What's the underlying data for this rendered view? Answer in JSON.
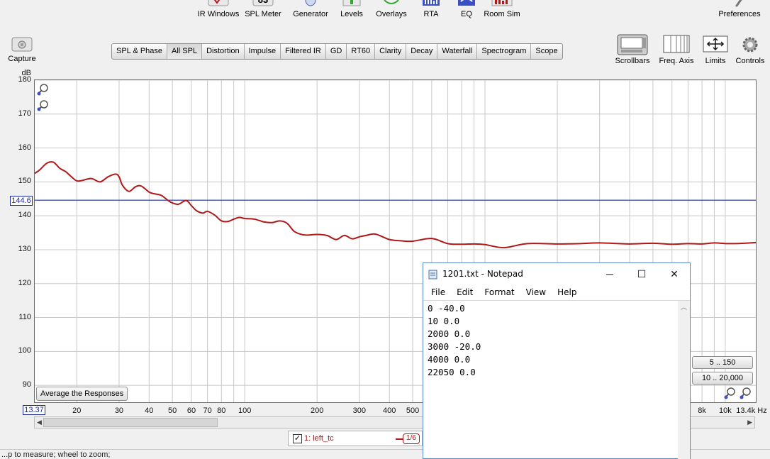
{
  "toolbar": {
    "top_items": [
      {
        "label": "IR Windows",
        "icon": "ir-windows-icon"
      },
      {
        "label": "SPL Meter",
        "icon": "spl-meter-icon",
        "display": "83"
      },
      {
        "label": "Generator",
        "icon": "generator-icon"
      },
      {
        "label": "Levels",
        "icon": "levels-icon"
      },
      {
        "label": "Overlays",
        "icon": "overlays-icon"
      },
      {
        "label": "RTA",
        "icon": "rta-icon"
      },
      {
        "label": "EQ",
        "icon": "eq-icon"
      },
      {
        "label": "Room Sim",
        "icon": "room-sim-icon"
      }
    ],
    "preferences": "Preferences",
    "capture": "Capture",
    "right_items": [
      {
        "label": "Scrollbars",
        "icon": "scrollbars-icon"
      },
      {
        "label": "Freq. Axis",
        "icon": "freq-axis-icon"
      },
      {
        "label": "Limits",
        "icon": "limits-icon"
      },
      {
        "label": "Controls",
        "icon": "gear-icon"
      }
    ]
  },
  "tabs": [
    "SPL & Phase",
    "All SPL",
    "Distortion",
    "Impulse",
    "Filtered IR",
    "GD",
    "RT60",
    "Clarity",
    "Decay",
    "Waterfall",
    "Spectrogram",
    "Scope"
  ],
  "active_tab": "All SPL",
  "graph": {
    "y_unit": "dB",
    "y_ticks": [
      "180",
      "170",
      "160",
      "150",
      "140",
      "130",
      "120",
      "110",
      "100",
      "90"
    ],
    "cursor_y": "144.6",
    "cursor_x": "13.37",
    "x_ticks": [
      "20",
      "30",
      "40",
      "50",
      "60",
      "70",
      "80",
      "100",
      "200",
      "300",
      "400",
      "500",
      "8k",
      "10k",
      "13.4k Hz"
    ],
    "average_button": "Average the Responses",
    "range_y_button": "5 .. 150",
    "range_x_button": "10 .. 20,000"
  },
  "chart_data": {
    "type": "line",
    "xscale": "log",
    "xlim": [
      13.37,
      13400
    ],
    "ylim": [
      85,
      180
    ],
    "ylabel": "dB",
    "cursor_level": 144.6,
    "colors": {
      "trace": "#b01818",
      "cursor": "#1f2a9c",
      "grid": "#c8c8c8"
    },
    "series": [
      {
        "name": "1: left_tc",
        "x": [
          13.37,
          14,
          15,
          16,
          17,
          18,
          19,
          20,
          21,
          23,
          25,
          27,
          29,
          30,
          31,
          33,
          35,
          37,
          40,
          42,
          45,
          48,
          50,
          53,
          57,
          60,
          63,
          67,
          70,
          75,
          80,
          85,
          90,
          95,
          100,
          110,
          120,
          130,
          140,
          150,
          160,
          170,
          180,
          200,
          220,
          240,
          260,
          280,
          300,
          320,
          350,
          400,
          450,
          500,
          600,
          700,
          800,
          900,
          1000,
          1200,
          1500,
          2000,
          2500,
          3000,
          4000,
          5000,
          6000,
          7000,
          8000,
          9000,
          10000,
          11000,
          12000,
          13400
        ],
        "y": [
          152.5,
          153.5,
          155.5,
          155.8,
          154,
          153,
          151.5,
          150.3,
          150.4,
          151,
          150,
          151.5,
          152.3,
          151.5,
          149,
          147.2,
          148.5,
          148.8,
          147,
          146.5,
          146,
          144.5,
          143.8,
          143.4,
          144.5,
          143,
          141.5,
          140.8,
          141.3,
          140.2,
          138.5,
          138.3,
          139,
          139.5,
          139.2,
          139,
          138.2,
          138,
          138.5,
          137.8,
          135.5,
          134.6,
          134.3,
          134.5,
          134.2,
          133,
          134.2,
          133.2,
          133.8,
          134.2,
          134.6,
          133,
          132.6,
          132.5,
          133.3,
          131.8,
          131.6,
          131.7,
          131.5,
          130.6,
          131.8,
          131.7,
          131.8,
          132,
          131.7,
          131.9,
          131.6,
          131.8,
          131.7,
          132,
          131.8,
          131.8,
          131.9,
          132.1
        ]
      }
    ]
  },
  "measurement": {
    "checked": true,
    "name": "1: left_tc",
    "smoothing": "1/6"
  },
  "status": "...p to measure; wheel to zoom;",
  "notepad": {
    "title": "1201.txt - Notepad",
    "menu": [
      "File",
      "Edit",
      "Format",
      "View",
      "Help"
    ],
    "lines": [
      "0 -40.0",
      "10 0.0",
      "2000 0.0",
      "3000 -20.0",
      "4000 0.0",
      "22050 0.0"
    ]
  }
}
